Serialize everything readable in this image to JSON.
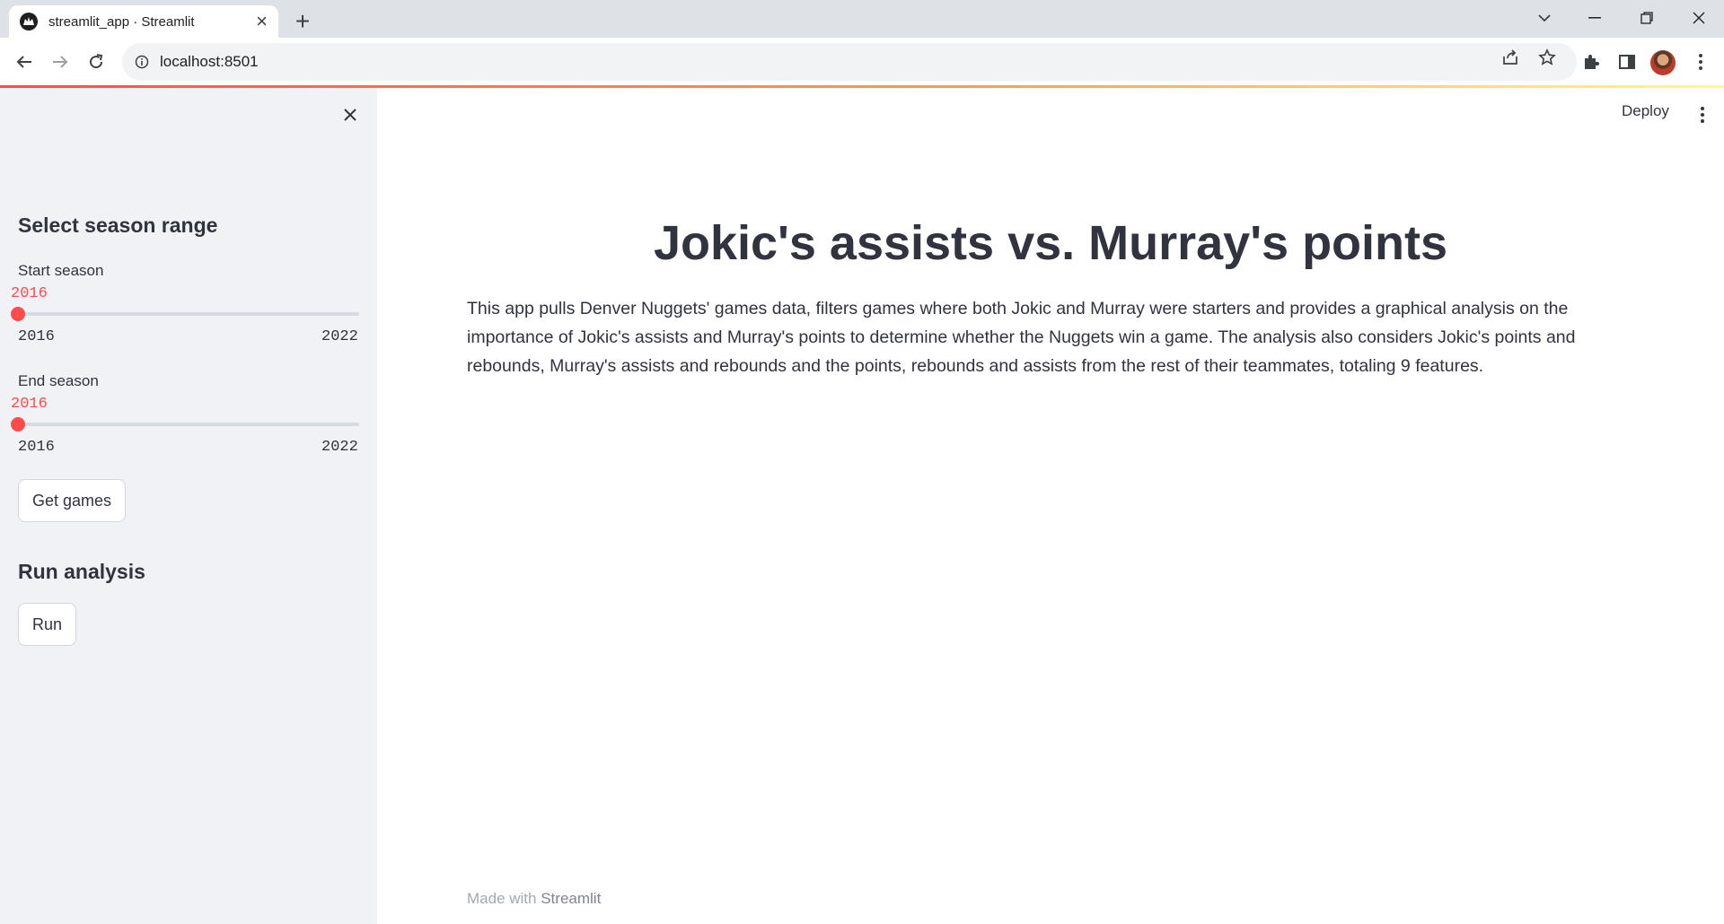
{
  "browser": {
    "tab_title": "streamlit_app · Streamlit",
    "url": "localhost:8501"
  },
  "sidebar": {
    "section1_heading": "Select season range",
    "start_slider": {
      "label": "Start season",
      "value": "2016",
      "min": "2016",
      "max": "2022",
      "fraction": 0
    },
    "end_slider": {
      "label": "End season",
      "value": "2016",
      "min": "2016",
      "max": "2022",
      "fraction": 0
    },
    "get_games_label": "Get games",
    "section2_heading": "Run analysis",
    "run_label": "Run"
  },
  "header": {
    "deploy_label": "Deploy"
  },
  "main": {
    "title": "Jokic's assists vs. Murray's points",
    "description": "This app pulls Denver Nuggets' games data, filters games where both Jokic and Murray were starters and provides a graphical analysis on the importance of Jokic's assists and Murray's points to determine whether the Nuggets win a game. The analysis also considers Jokic's points and rebounds, Murray's assists and rebounds and the points, rebounds and assists from the rest of their teammates, totaling 9 features."
  },
  "footer": {
    "prefix": "Made with",
    "link": "Streamlit"
  },
  "colors": {
    "accent": "#ff4b4b",
    "sidebar_bg": "#f0f2f6",
    "text": "#31333f"
  },
  "icons": [
    "streamlit-favicon-icon",
    "tab-close-icon",
    "new-tab-icon",
    "tab-search-icon",
    "minimize-icon",
    "restore-icon",
    "window-close-icon",
    "back-icon",
    "forward-icon",
    "reload-icon",
    "site-info-icon",
    "share-icon",
    "bookmark-star-icon",
    "extensions-icon",
    "side-panel-icon",
    "kebab-menu-icon",
    "sidebar-close-icon"
  ]
}
